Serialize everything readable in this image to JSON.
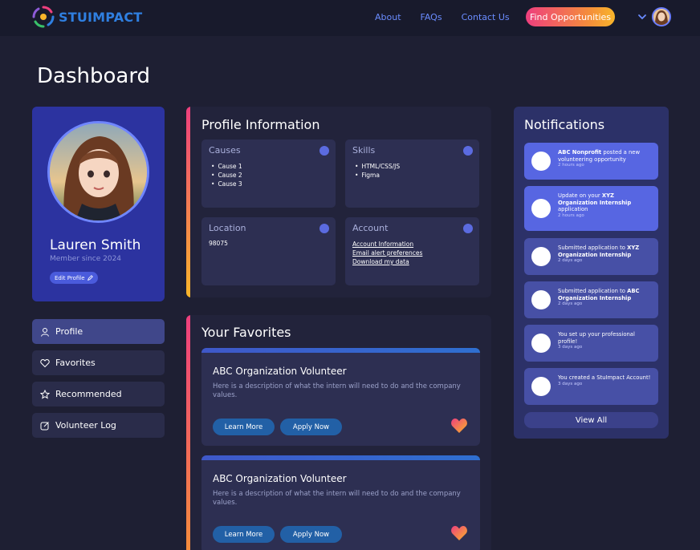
{
  "nav": {
    "logo_text": "STUIMPACT",
    "links": [
      "About",
      "FAQs",
      "Contact Us"
    ],
    "cta": "Find Opportunities"
  },
  "page_title": "Dashboard",
  "profile": {
    "name": "Lauren Smith",
    "member_since": "Member since 2024",
    "edit_label": "Edit Profile"
  },
  "sidebar": {
    "items": [
      {
        "label": "Profile",
        "icon": "user-icon"
      },
      {
        "label": "Favorites",
        "icon": "heart-icon"
      },
      {
        "label": "Recommended",
        "icon": "star-icon"
      },
      {
        "label": "Volunteer Log",
        "icon": "edit-icon"
      }
    ]
  },
  "profile_info": {
    "title": "Profile Information",
    "causes": {
      "title": "Causes",
      "items": [
        "Cause 1",
        "Cause 2",
        "Cause 3"
      ]
    },
    "skills": {
      "title": "Skills",
      "items": [
        "HTML/CSS/JS",
        "Figma"
      ]
    },
    "location": {
      "title": "Location",
      "value": "98075"
    },
    "account": {
      "title": "Account",
      "links": [
        "Account Information",
        "Email alert preferences",
        "Download my data"
      ]
    }
  },
  "favorites": {
    "title": "Your Favorites",
    "cards": [
      {
        "title": "ABC Organization Volunteer",
        "description": "Here is a description of what the intern will need to do and the company values.",
        "learn_more": "Learn More",
        "apply_now": "Apply Now"
      },
      {
        "title": "ABC Organization Volunteer",
        "description": "Here is a description of what the intern will need to do and the company values.",
        "learn_more": "Learn More",
        "apply_now": "Apply Now"
      }
    ]
  },
  "notifications": {
    "title": "Notifications",
    "items": [
      {
        "bold": "ABC Nonprofit",
        "text": " posted a new volunteering opportunity",
        "time": "2 hours ago"
      },
      {
        "pre": "Update on your ",
        "bold": "XYZ Organization Internship",
        "text": " application",
        "time": "2 hours ago"
      },
      {
        "pre": "Submitted application to ",
        "bold": "XYZ Organization Internship",
        "text": "",
        "time": "2 days ago"
      },
      {
        "pre": "Submitted application to ",
        "bold": "ABC Organization Internship",
        "text": "",
        "time": "2 days ago"
      },
      {
        "pre": "You set up your professional profile!",
        "bold": "",
        "text": "",
        "time": "3 days ago"
      },
      {
        "pre": "You created a StuImpact Account!",
        "bold": "",
        "text": "",
        "time": "3 days ago"
      }
    ],
    "view_all": "View All"
  },
  "colors": {
    "background": "#1e1f33",
    "nav": "#181a2c",
    "accent_gradient": [
      "#ee3f7e",
      "#f8b52a"
    ],
    "profile_card": "#2c33a0",
    "notification_panel": "#2c3168"
  }
}
